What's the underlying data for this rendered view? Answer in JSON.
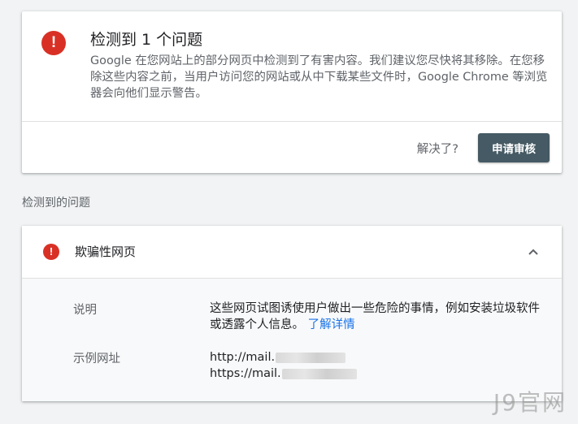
{
  "issue_card": {
    "title": "检测到 1 个问题",
    "description": "Google 在您网站上的部分网页中检测到了有害内容。我们建议您尽快将其移除。在您移除这些内容之前，当用户访问您的网站或从中下载某些文件时，Google Chrome 等浏览器会向他们显示警告。",
    "resolved_prompt": "解决了?",
    "review_button_label": "申请审核",
    "alert_glyph": "!"
  },
  "section_label": "检测到的问题",
  "detail_card": {
    "title": "欺骗性网页",
    "alert_glyph": "!",
    "expanded": true,
    "rows": {
      "description_label": "说明",
      "description_text": "这些网页试图诱使用户做出一些危险的事情，例如安装垃圾软件或透露个人信息。",
      "learn_more_link": "了解详情",
      "example_url_label": "示例网址",
      "example_urls": [
        "http://mail.",
        "https://mail."
      ]
    }
  },
  "watermark": "J9官网",
  "colors": {
    "alert_red": "#d93025",
    "button_bg": "#455a64",
    "link_blue": "#1a73e8",
    "page_bg": "#f1f3f4"
  },
  "icons": {
    "alert": "error-circle-icon",
    "collapse": "chevron-up-icon"
  }
}
